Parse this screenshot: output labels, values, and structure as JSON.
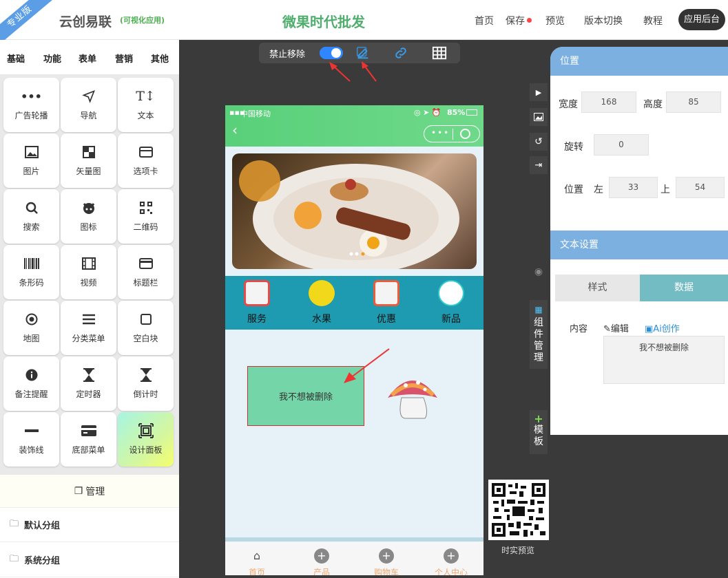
{
  "header": {
    "edition_ribbon": "专业版",
    "brand": "云创易联",
    "brand_sub": "(可视化应用)",
    "center_title": "微果时代批发",
    "nav": [
      "首页",
      "保存",
      "预览",
      "版本切换",
      "教程",
      "应用后台"
    ]
  },
  "left_panel": {
    "categories": [
      "基础",
      "功能",
      "表单",
      "营销",
      "其他"
    ],
    "components": [
      {
        "label": "广告轮播",
        "icon": "carousel-icon"
      },
      {
        "label": "导航",
        "icon": "navigation-icon"
      },
      {
        "label": "文本",
        "icon": "text-icon"
      },
      {
        "label": "图片",
        "icon": "image-icon"
      },
      {
        "label": "矢量图",
        "icon": "vector-icon"
      },
      {
        "label": "选项卡",
        "icon": "tabs-icon"
      },
      {
        "label": "搜索",
        "icon": "search-icon"
      },
      {
        "label": "图标",
        "icon": "github-icon"
      },
      {
        "label": "二维码",
        "icon": "qrcode-icon"
      },
      {
        "label": "条形码",
        "icon": "barcode-icon"
      },
      {
        "label": "视频",
        "icon": "video-icon"
      },
      {
        "label": "标题栏",
        "icon": "titlebar-icon"
      },
      {
        "label": "地图",
        "icon": "compass-icon"
      },
      {
        "label": "分类菜单",
        "icon": "menu-icon"
      },
      {
        "label": "空白块",
        "icon": "blank-square-icon"
      },
      {
        "label": "备注提醒",
        "icon": "info-icon"
      },
      {
        "label": "定时器",
        "icon": "hourglass-icon"
      },
      {
        "label": "倒计时",
        "icon": "hourglass-icon"
      },
      {
        "label": "装饰线",
        "icon": "line-icon"
      },
      {
        "label": "底部菜单",
        "icon": "card-icon"
      },
      {
        "label": "设计面板",
        "icon": "frame-icon"
      }
    ],
    "manage_label": "管理",
    "groups": [
      "默认分组",
      "系统分组"
    ]
  },
  "toolbar": {
    "toggle_label": "禁止移除",
    "toggle_on": true
  },
  "phone": {
    "carrier": "中国移动",
    "battery": "85%",
    "banner_dots": 3,
    "banner_active_dot": 3,
    "nav_items": [
      "服务",
      "水果",
      "优惠",
      "新品"
    ],
    "text_box_text": "我不想被删除",
    "tabs": [
      "首页",
      "产品",
      "购物车",
      "个人中心"
    ]
  },
  "right_rail": {
    "component_manager": [
      "组",
      "件",
      "管",
      "理"
    ],
    "template": [
      "模",
      "板"
    ],
    "qr_label": "时实预览"
  },
  "props": {
    "position_title": "位置",
    "width_label": "宽度",
    "width_value": "168",
    "height_label": "高度",
    "height_value": "85",
    "rotate_label": "旋转",
    "rotate_value": "0",
    "pos_label": "位置",
    "left_label": "左",
    "left_value": "33",
    "top_label": "上",
    "top_value": "54",
    "text_title": "文本设置",
    "tab_style": "样式",
    "tab_data": "数据",
    "content_label": "内容",
    "edit_label": "编辑",
    "ai_label": "Ai创作",
    "content_value": "我不想被删除"
  },
  "colors": {
    "accent_blue": "#2f86ff",
    "brand_green": "#4fae6d",
    "section_head": "#7bb0e0",
    "active_tab": "#74bcc3"
  }
}
